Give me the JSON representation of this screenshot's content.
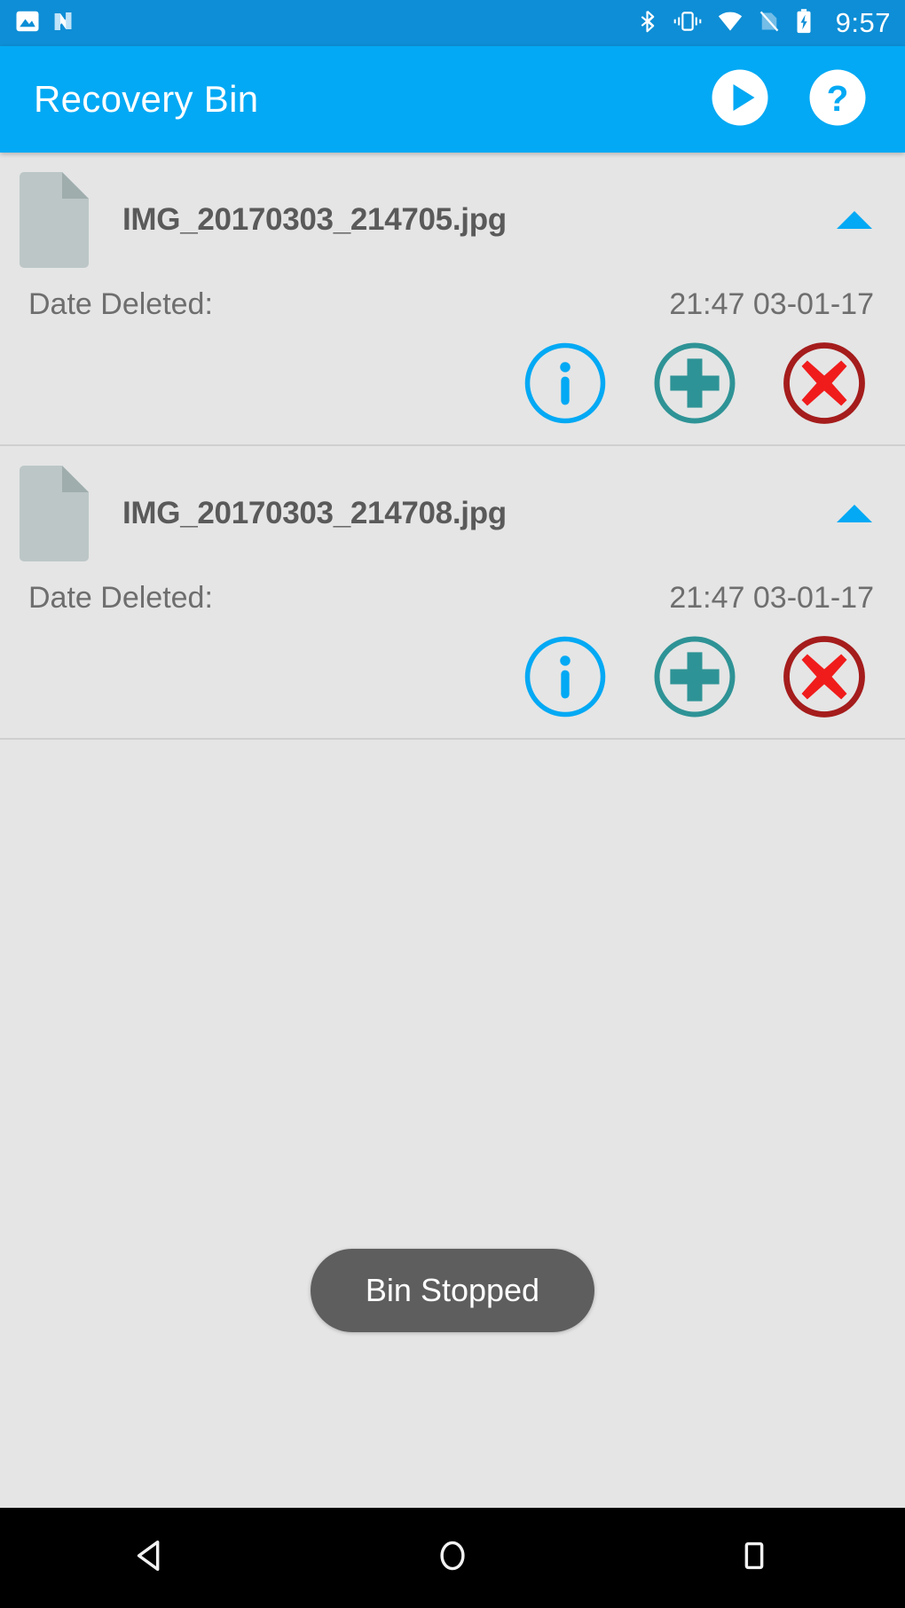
{
  "status_bar": {
    "time": "9:57",
    "left_icons": [
      "photo-icon",
      "android-n-icon"
    ],
    "right_icons": [
      "bluetooth-icon",
      "vibrate-icon",
      "wifi-icon",
      "no-sim-icon",
      "battery-charging-icon"
    ],
    "background_color": "#0e8ed6"
  },
  "app_bar": {
    "title": "Recovery Bin",
    "background_color": "#03a9f4",
    "actions": [
      {
        "name": "play-icon",
        "label": "Start Bin"
      },
      {
        "name": "help-icon",
        "label": "Help"
      }
    ]
  },
  "list": {
    "items": [
      {
        "file_icon": "file-document-icon",
        "filename": "IMG_20170303_214705.jpg",
        "collapse_icon": "chevron-up-icon",
        "date_label": "Date Deleted:",
        "date_value": "21:47 03-01-17",
        "actions": [
          {
            "name": "info-icon",
            "label": "Info",
            "color": "#03a9f4"
          },
          {
            "name": "restore-plus-icon",
            "label": "Restore",
            "color": "#2e9396"
          },
          {
            "name": "delete-x-icon",
            "label": "Delete",
            "color": "#a51c1c"
          }
        ]
      },
      {
        "file_icon": "file-document-icon",
        "filename": "IMG_20170303_214708.jpg",
        "collapse_icon": "chevron-up-icon",
        "date_label": "Date Deleted:",
        "date_value": "21:47 03-01-17",
        "actions": [
          {
            "name": "info-icon",
            "label": "Info",
            "color": "#03a9f4"
          },
          {
            "name": "restore-plus-icon",
            "label": "Restore",
            "color": "#2e9396"
          },
          {
            "name": "delete-x-icon",
            "label": "Delete",
            "color": "#a51c1c"
          }
        ]
      }
    ]
  },
  "toast": {
    "message": "Bin Stopped",
    "background_color": "#5e5e5e"
  },
  "nav_bar": {
    "buttons": [
      {
        "name": "back-button",
        "label": "Back"
      },
      {
        "name": "home-button",
        "label": "Home"
      },
      {
        "name": "recents-button",
        "label": "Recents"
      }
    ],
    "background_color": "#000000"
  },
  "colors": {
    "accent": "#03a9f4",
    "status_bar": "#0e8ed6",
    "page_background": "#e5e5e5",
    "restore_green": "#2e9396",
    "delete_red": "#a51c1c",
    "delete_x": "#f01c1c",
    "text_primary": "#5a5a5a",
    "text_secondary": "#6e6e6e"
  }
}
